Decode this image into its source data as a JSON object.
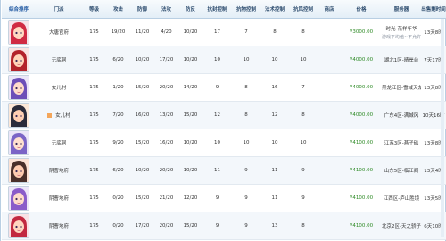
{
  "header": {
    "sort_label": "综合排序",
    "sect": "门派",
    "level": "等级",
    "attack": "攻击",
    "defense": "防御",
    "hp": "法攻",
    "mp": "防反",
    "ctrl": "抗封控制",
    "resist_ctrl": "抗物控制",
    "magic_ctrl": "法术控制",
    "resist_magic": "抗风控制",
    "shop": "商店",
    "price": "价格",
    "server": "服务器",
    "time": "出售剩时间"
  },
  "rows": [
    {
      "sect": "大唐官府",
      "level": "175",
      "atk": "19/20",
      "def": "11/20",
      "hp": "4/20",
      "mp": "10/20",
      "c1": "17",
      "c2": "7",
      "c3": "8",
      "c4": "8",
      "price": "¥3000.00",
      "server": "时光-花样年华",
      "server_note": "游戏平均值~不允许议价",
      "time": "13天8时",
      "badge": false
    },
    {
      "sect": "无底洞",
      "level": "175",
      "atk": "6/20",
      "def": "10/20",
      "hp": "17/20",
      "mp": "10/20",
      "c1": "10",
      "c2": "10",
      "c3": "10",
      "c4": "10",
      "price": "¥4000.00",
      "server": "湖北1区-晴岸台",
      "server_note": "",
      "time": "7天17时",
      "badge": false
    },
    {
      "sect": "女儿村",
      "level": "175",
      "atk": "1/20",
      "def": "15/20",
      "hp": "20/20",
      "mp": "14/20",
      "c1": "9",
      "c2": "8",
      "c3": "16",
      "c4": "7",
      "price": "¥4000.00",
      "server": "黑龙江区-雪域天龙",
      "server_note": "",
      "time": "13天8时",
      "badge": false
    },
    {
      "sect": "女儿村",
      "level": "175",
      "atk": "7/20",
      "def": "16/20",
      "hp": "13/20",
      "mp": "15/20",
      "c1": "12",
      "c2": "8",
      "c3": "12",
      "c4": "8",
      "price": "¥4000.00",
      "server": "广东4区-满城风",
      "server_note": "",
      "time": "10天16时",
      "badge": true
    },
    {
      "sect": "无底洞",
      "level": "175",
      "atk": "9/20",
      "def": "15/20",
      "hp": "16/20",
      "mp": "10/20",
      "c1": "10",
      "c2": "10",
      "c3": "10",
      "c4": "10",
      "price": "¥4100.00",
      "server": "江苏3区-燕子矶",
      "server_note": "",
      "time": "13天8时",
      "badge": false
    },
    {
      "sect": "阴曹地府",
      "level": "175",
      "atk": "6/20",
      "def": "10/20",
      "hp": "20/20",
      "mp": "10/20",
      "c1": "11",
      "c2": "9",
      "c3": "11",
      "c4": "9",
      "price": "¥4100.00",
      "server": "山东5区-临江阁",
      "server_note": "",
      "time": "13天4时",
      "badge": false
    },
    {
      "sect": "阴曹地府",
      "level": "175",
      "atk": "0/20",
      "def": "15/20",
      "hp": "21/20",
      "mp": "12/20",
      "c1": "9",
      "c2": "9",
      "c3": "11",
      "c4": "9",
      "price": "¥4100.00",
      "server": "江西区-庐山胜境",
      "server_note": "",
      "time": "13天5时",
      "badge": false
    },
    {
      "sect": "阴曹地府",
      "level": "175",
      "atk": "0/20",
      "def": "17/20",
      "hp": "20/20",
      "mp": "15/20",
      "c1": "9",
      "c2": "9",
      "c3": "13",
      "c4": "8",
      "price": "¥4100.00",
      "server": "北京2区-天之骄子",
      "server_note": "",
      "time": "6天10时",
      "badge": false
    }
  ],
  "avatar_palette": [
    {
      "hair": "#d02a43",
      "skin": "#ffd9c2",
      "bg": "#f6e3ea"
    },
    {
      "hair": "#b3232b",
      "skin": "#ffd3b8",
      "bg": "#f9e4e2"
    },
    {
      "hair": "#6d4fb8",
      "skin": "#ffdccb",
      "bg": "#ece6f7"
    },
    {
      "hair": "#2b2b3a",
      "skin": "#ffcfb3",
      "bg": "#fde8d8"
    },
    {
      "hair": "#7b64c6",
      "skin": "#ffe0cf",
      "bg": "#ebe6f8"
    },
    {
      "hair": "#4a2f2a",
      "skin": "#ffcbb0",
      "bg": "#fde2d5"
    },
    {
      "hair": "#8b5cc9",
      "skin": "#ffdccb",
      "bg": "#eee6f8"
    },
    {
      "hair": "#c22840",
      "skin": "#ffd6c0",
      "bg": "#f9e2e6"
    }
  ],
  "colors": {
    "price": "#2f8b27",
    "link": "#1b55a0",
    "header_text": "#2d4c6e"
  }
}
